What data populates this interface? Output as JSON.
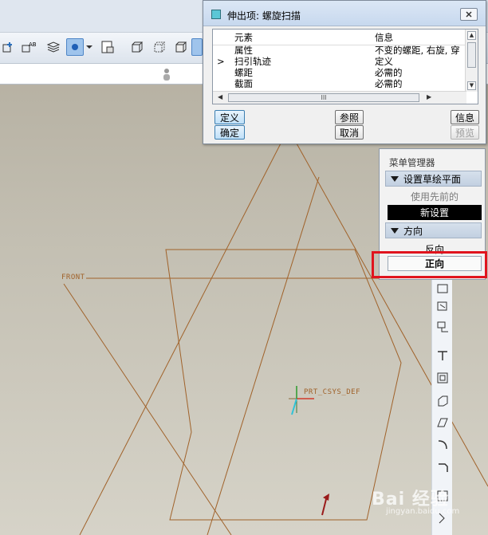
{
  "dialog": {
    "title": "伸出项: 螺旋扫描",
    "columns": {
      "element": "元素",
      "info": "信息"
    },
    "rows": [
      {
        "marker": "",
        "element": "属性",
        "info": "不变的螺距, 右旋, 穿"
      },
      {
        "marker": ">",
        "element": "扫引轨迹",
        "info": "定义"
      },
      {
        "marker": "",
        "element": "螺距",
        "info": "必需的"
      },
      {
        "marker": "",
        "element": "截面",
        "info": "必需的"
      }
    ],
    "scroll_mark": "III",
    "buttons": {
      "define": "定义",
      "reference": "参照",
      "info": "信息",
      "ok": "确定",
      "cancel": "取消",
      "preview": "预览"
    }
  },
  "menu_manager": {
    "title": "菜单管理器",
    "section1": "设置草绘平面",
    "use_previous": "使用先前的",
    "new_setting": "新设置",
    "section2": "方向",
    "flip": "反向",
    "forward": "正向"
  },
  "viewport": {
    "plane_label": "FRONT",
    "csys_label": "PRT_CSYS_DEF",
    "line_color": "#a0622a"
  },
  "watermark": {
    "brand": "Bai 经验",
    "url": "jingyan.baidu.com"
  }
}
